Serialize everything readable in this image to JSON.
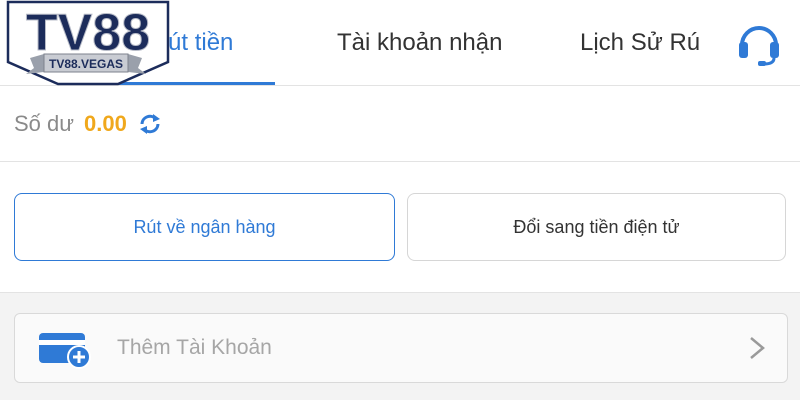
{
  "header": {
    "tabs": [
      {
        "label": "u rút tiền",
        "active": true
      },
      {
        "label": "Tài khoản nhận",
        "active": false
      },
      {
        "label": "Lịch Sử Rú",
        "active": false
      }
    ],
    "support_icon": "headset-icon"
  },
  "logo": {
    "text": "TV88",
    "ribbon_text": "TV88.VEGAS"
  },
  "balance": {
    "label": "Số dư",
    "amount": "0.00",
    "refresh_icon": "refresh-icon"
  },
  "withdraw_options": {
    "bank_label": "Rút về ngân hàng",
    "crypto_label": "Đổi sang tiền điện tử"
  },
  "account": {
    "add_label": "Thêm Tài Khoản",
    "card_icon": "add-card-icon",
    "chevron_icon": "chevron-right-icon"
  },
  "colors": {
    "accent": "#2f7ad6",
    "amount": "#f0a81c",
    "logo_navy": "#1c2c5b"
  }
}
